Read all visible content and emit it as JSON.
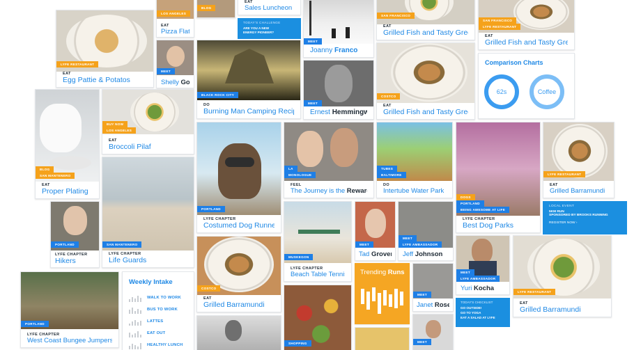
{
  "cards": {
    "sales_luncheon": {
      "category": "EAT",
      "title": "Sales Luncheon"
    },
    "los_angeles_top": {
      "tag": "LOS ANGELES"
    },
    "pizza": {
      "tag": "BLOG",
      "category": "EAT",
      "title": "Pizza Flats"
    },
    "challenge": {
      "label": "TODAY'S CHALLENGE",
      "text": "ARE YOU A NEW ENERGY PIONEER?"
    },
    "egg": {
      "tag": "LYFE RESTAURANT",
      "category": "EAT",
      "title": "Egg Pattie & Potatos"
    },
    "shelly": {
      "tag": "MEET",
      "title_first": "Shelly",
      "title_last": "Gos"
    },
    "burning_man": {
      "tag": "BLACK ROCK CITY",
      "category": "DO",
      "title": "Burning Man Camping Recipes"
    },
    "joanny": {
      "tag": "MEET",
      "title_first": "Joanny",
      "title_last": "Franco"
    },
    "ernest": {
      "tag": "MEET",
      "title_first": "Ernest",
      "title_last": "Hemmingway"
    },
    "grilled_top": {
      "tag": "SAN FRANCISCO",
      "category": "EAT",
      "title": "Grilled Fish and Tasty Greens"
    },
    "grilled_costco": {
      "tag": "COSTCO",
      "category": "EAT",
      "title": "Grilled Fish and Tasty Greens"
    },
    "grilled_right": {
      "tag1": "SAN FRANCISCO",
      "tag2": "LYFE RESTAURANT",
      "category": "EAT",
      "title": "Grilled Fish and Tasty Greens"
    },
    "comparison": {
      "title": "Comparison Charts",
      "left": "62s",
      "right": "Coffee"
    },
    "proper_plating": {
      "tag": "BLOG",
      "tag2": "SAN MANTENERO",
      "category": "EAT",
      "title": "Proper Plating"
    },
    "broccoli": {
      "tag1": "BUY NOW",
      "tag2": "LOS ANGELES",
      "category": "EAT",
      "title": "Broccoli Pilaf"
    },
    "dog_runners": {
      "tag": "PORTLAND",
      "category": "LYFE CHAPTER",
      "title": "Costumed Dog Runners"
    },
    "journey": {
      "tag1": "LA",
      "tag2": "MONOLOGUE",
      "category": "FEEL",
      "title_first": "The Journey is the",
      "title_last": "Reward"
    },
    "intertube": {
      "tag1": "TUBES",
      "tag2": "BALTIMORE",
      "category": "DO",
      "title": "Intertube Water Park"
    },
    "dog_parks": {
      "tag1": "DOGS",
      "tag2": "PORTLAND",
      "tag3": "BEING AWESOME AT LIFE",
      "category": "LYFE CHAPTER",
      "title": "Best Dog Parks"
    },
    "barramundi_top": {
      "tag": "LYFE RESTAURANT",
      "category": "EAT",
      "title": "Grilled Barramundi"
    },
    "local_event": {
      "label": "LOCAL EVENT",
      "line1": "5KM RUN",
      "line2": "SPONSORED BY BROOKS RUNNING",
      "cta": "REGISTER NOW"
    },
    "hikers": {
      "tag": "PORTLAND",
      "category": "LYFE CHAPTER",
      "title": "Hikers"
    },
    "life_guards": {
      "tag": "SAN MANTENERO",
      "category": "LYFE CHAPTER",
      "title": "Life Guards"
    },
    "beach_tennis": {
      "tag": "MUSKEGON",
      "category": "LYFE CHAPTER",
      "title": "Beach Table Tennis"
    },
    "tad": {
      "tag": "MEET",
      "title_first": "Tad",
      "title_last": "Grover"
    },
    "jeff": {
      "tag1": "MEET",
      "tag2": "LYFE AMBASSADOR",
      "title_first": "Jeff",
      "title_last": "Johnson"
    },
    "yuri": {
      "tag1": "MEET",
      "tag2": "LYFE AMBASSADOR",
      "title_first": "Yuri",
      "title_last": "Kocha"
    },
    "barramundi_right": {
      "tag": "LYFE RESTAURANT",
      "category": "EAT",
      "title": "Grilled Barramundi"
    },
    "barramundi_costco": {
      "tag": "COSTCO",
      "category": "EAT",
      "title": "Grilled Barramundi"
    },
    "trending": {
      "title_first": "Trending",
      "title_last": "Runs"
    },
    "janet": {
      "tag": "MEET",
      "title_first": "Janet",
      "title_last": "Rose"
    },
    "checklist": {
      "label": "TODAY'S CHECKLIST",
      "items": [
        "GO OUTSIDE!",
        "GO TO YOGA",
        "EAT A SALAD AT LYFE"
      ]
    },
    "west_coast": {
      "tag": "PORTLAND",
      "category": "LYFE CHAPTER",
      "title": "West Coast Bungee Jumpers"
    },
    "shopping": {
      "tag": "SHOPPING"
    },
    "meet_bottom": {
      "tag": "MEET"
    },
    "weekly": {
      "title": "Weekly Intake",
      "rows": [
        "WALK TO WORK",
        "BUS TO WORK",
        "LATTES",
        "EAT OUT",
        "HEALTHY LUNCH"
      ]
    }
  },
  "colors": {
    "accent": "#1e88e5",
    "orange": "#f5a21b",
    "blue_tag": "#1e7fe6",
    "trending": "#f5a623"
  }
}
